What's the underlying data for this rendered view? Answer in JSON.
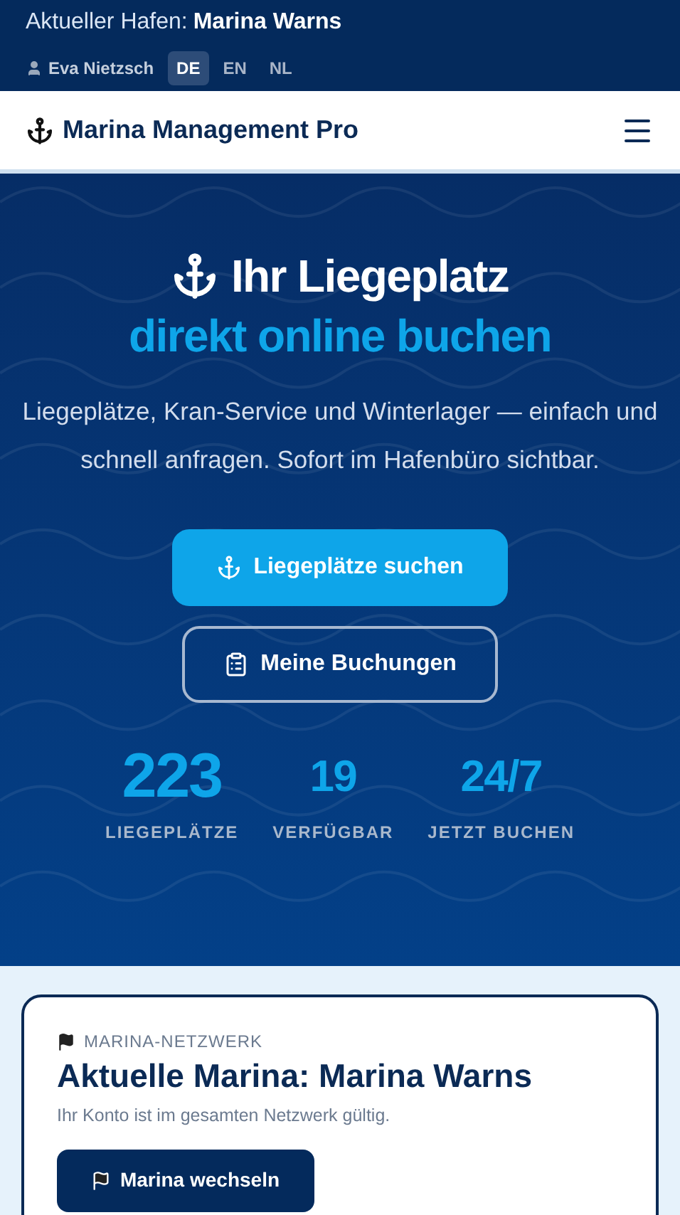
{
  "topbar": {
    "harbor_label": "Aktueller Hafen:",
    "harbor_name": "Marina Warns",
    "user": "Eva Nietzsch",
    "languages": [
      {
        "label": "DE",
        "selected": true
      },
      {
        "label": "EN",
        "selected": false
      },
      {
        "label": "NL",
        "selected": false
      }
    ]
  },
  "navbar": {
    "brand": "Marina Management Pro"
  },
  "hero": {
    "title": "Ihr Liegeplatz",
    "subtitle": "direkt online buchen",
    "text": "Liegeplätze, Kran-Service und Winterlager — einfach und schnell anfragen. Sofort im Hafenbüro sichtbar.",
    "buttons": [
      {
        "label": "Liegeplätze suchen",
        "kind": "primary"
      },
      {
        "label": "Meine Buchungen",
        "kind": "outline"
      }
    ],
    "stats": [
      {
        "value": "223",
        "label": "LIEGEPLÄTZE",
        "kind": "large"
      },
      {
        "value": "19",
        "label": "VERFÜGBAR",
        "kind": "normal"
      },
      {
        "value": "24/7",
        "label": "JETZT BUCHEN",
        "kind": "normal"
      }
    ]
  },
  "network_card": {
    "eyebrow": "MARINA-NETZWERK",
    "title": "Aktuelle Marina: Marina Warns",
    "text": "Ihr Konto ist im gesamten Netzwerk gültig.",
    "button": "Marina wechseln"
  }
}
